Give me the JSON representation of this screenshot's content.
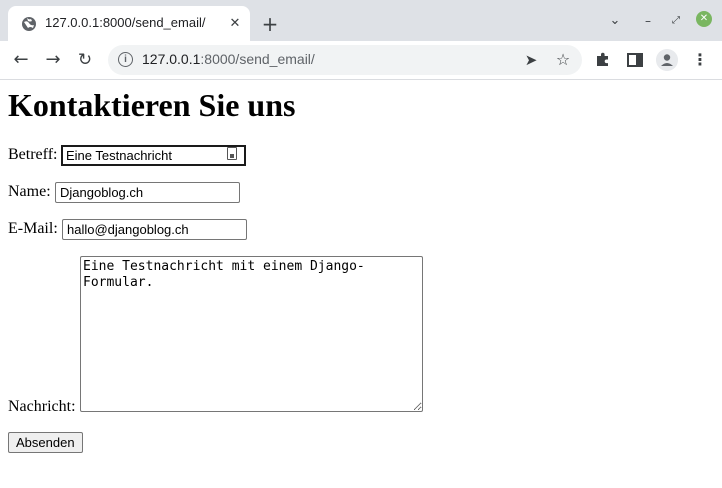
{
  "browser": {
    "tab_title": "127.0.0.1:8000/send_email/",
    "tab_close_glyph": "✕",
    "new_tab_glyph": "+",
    "url_host": "127.0.0.1",
    "url_path": ":8000/send_email/",
    "icons": {
      "favicon": "globe-icon",
      "back": "arrow-left-icon",
      "forward": "arrow-right-icon",
      "reload": "reload-icon",
      "info": "info-icon",
      "send": "send-icon",
      "bookmark": "star-icon",
      "extensions": "puzzle-icon",
      "side_panel": "side-panel-icon",
      "profile": "profile-icon",
      "menu": "kebab-menu-icon"
    },
    "colors": {
      "tabstrip": "#dee1e6",
      "omnibox": "#f1f3f4",
      "close_button": "#7ab661"
    }
  },
  "page": {
    "heading": "Kontaktieren Sie uns",
    "form": {
      "subject_label": "Betreff:",
      "subject_value": "Eine Testnachricht",
      "name_label": "Name:",
      "name_value": "Djangoblog.ch",
      "email_label": "E-Mail:",
      "email_value": "hallo@djangoblog.ch",
      "message_label": "Nachricht:",
      "message_value": "Eine Testnachricht mit einem Django-Formular.",
      "submit_label": "Absenden"
    }
  }
}
